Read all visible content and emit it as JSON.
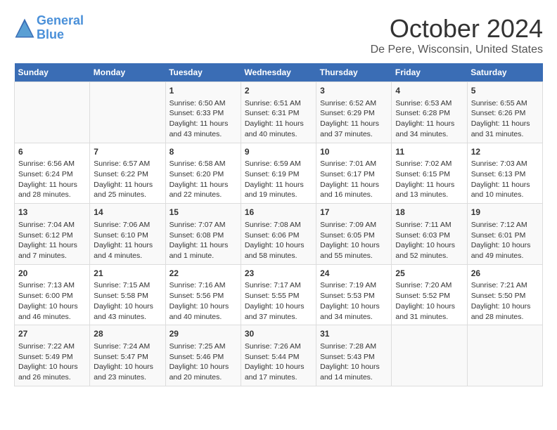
{
  "header": {
    "logo_line1": "General",
    "logo_line2": "Blue",
    "month": "October 2024",
    "location": "De Pere, Wisconsin, United States"
  },
  "days_of_week": [
    "Sunday",
    "Monday",
    "Tuesday",
    "Wednesday",
    "Thursday",
    "Friday",
    "Saturday"
  ],
  "weeks": [
    [
      {
        "day": "",
        "content": ""
      },
      {
        "day": "",
        "content": ""
      },
      {
        "day": "1",
        "content": "Sunrise: 6:50 AM\nSunset: 6:33 PM\nDaylight: 11 hours and 43 minutes."
      },
      {
        "day": "2",
        "content": "Sunrise: 6:51 AM\nSunset: 6:31 PM\nDaylight: 11 hours and 40 minutes."
      },
      {
        "day": "3",
        "content": "Sunrise: 6:52 AM\nSunset: 6:29 PM\nDaylight: 11 hours and 37 minutes."
      },
      {
        "day": "4",
        "content": "Sunrise: 6:53 AM\nSunset: 6:28 PM\nDaylight: 11 hours and 34 minutes."
      },
      {
        "day": "5",
        "content": "Sunrise: 6:55 AM\nSunset: 6:26 PM\nDaylight: 11 hours and 31 minutes."
      }
    ],
    [
      {
        "day": "6",
        "content": "Sunrise: 6:56 AM\nSunset: 6:24 PM\nDaylight: 11 hours and 28 minutes."
      },
      {
        "day": "7",
        "content": "Sunrise: 6:57 AM\nSunset: 6:22 PM\nDaylight: 11 hours and 25 minutes."
      },
      {
        "day": "8",
        "content": "Sunrise: 6:58 AM\nSunset: 6:20 PM\nDaylight: 11 hours and 22 minutes."
      },
      {
        "day": "9",
        "content": "Sunrise: 6:59 AM\nSunset: 6:19 PM\nDaylight: 11 hours and 19 minutes."
      },
      {
        "day": "10",
        "content": "Sunrise: 7:01 AM\nSunset: 6:17 PM\nDaylight: 11 hours and 16 minutes."
      },
      {
        "day": "11",
        "content": "Sunrise: 7:02 AM\nSunset: 6:15 PM\nDaylight: 11 hours and 13 minutes."
      },
      {
        "day": "12",
        "content": "Sunrise: 7:03 AM\nSunset: 6:13 PM\nDaylight: 11 hours and 10 minutes."
      }
    ],
    [
      {
        "day": "13",
        "content": "Sunrise: 7:04 AM\nSunset: 6:12 PM\nDaylight: 11 hours and 7 minutes."
      },
      {
        "day": "14",
        "content": "Sunrise: 7:06 AM\nSunset: 6:10 PM\nDaylight: 11 hours and 4 minutes."
      },
      {
        "day": "15",
        "content": "Sunrise: 7:07 AM\nSunset: 6:08 PM\nDaylight: 11 hours and 1 minute."
      },
      {
        "day": "16",
        "content": "Sunrise: 7:08 AM\nSunset: 6:06 PM\nDaylight: 10 hours and 58 minutes."
      },
      {
        "day": "17",
        "content": "Sunrise: 7:09 AM\nSunset: 6:05 PM\nDaylight: 10 hours and 55 minutes."
      },
      {
        "day": "18",
        "content": "Sunrise: 7:11 AM\nSunset: 6:03 PM\nDaylight: 10 hours and 52 minutes."
      },
      {
        "day": "19",
        "content": "Sunrise: 7:12 AM\nSunset: 6:01 PM\nDaylight: 10 hours and 49 minutes."
      }
    ],
    [
      {
        "day": "20",
        "content": "Sunrise: 7:13 AM\nSunset: 6:00 PM\nDaylight: 10 hours and 46 minutes."
      },
      {
        "day": "21",
        "content": "Sunrise: 7:15 AM\nSunset: 5:58 PM\nDaylight: 10 hours and 43 minutes."
      },
      {
        "day": "22",
        "content": "Sunrise: 7:16 AM\nSunset: 5:56 PM\nDaylight: 10 hours and 40 minutes."
      },
      {
        "day": "23",
        "content": "Sunrise: 7:17 AM\nSunset: 5:55 PM\nDaylight: 10 hours and 37 minutes."
      },
      {
        "day": "24",
        "content": "Sunrise: 7:19 AM\nSunset: 5:53 PM\nDaylight: 10 hours and 34 minutes."
      },
      {
        "day": "25",
        "content": "Sunrise: 7:20 AM\nSunset: 5:52 PM\nDaylight: 10 hours and 31 minutes."
      },
      {
        "day": "26",
        "content": "Sunrise: 7:21 AM\nSunset: 5:50 PM\nDaylight: 10 hours and 28 minutes."
      }
    ],
    [
      {
        "day": "27",
        "content": "Sunrise: 7:22 AM\nSunset: 5:49 PM\nDaylight: 10 hours and 26 minutes."
      },
      {
        "day": "28",
        "content": "Sunrise: 7:24 AM\nSunset: 5:47 PM\nDaylight: 10 hours and 23 minutes."
      },
      {
        "day": "29",
        "content": "Sunrise: 7:25 AM\nSunset: 5:46 PM\nDaylight: 10 hours and 20 minutes."
      },
      {
        "day": "30",
        "content": "Sunrise: 7:26 AM\nSunset: 5:44 PM\nDaylight: 10 hours and 17 minutes."
      },
      {
        "day": "31",
        "content": "Sunrise: 7:28 AM\nSunset: 5:43 PM\nDaylight: 10 hours and 14 minutes."
      },
      {
        "day": "",
        "content": ""
      },
      {
        "day": "",
        "content": ""
      }
    ]
  ]
}
